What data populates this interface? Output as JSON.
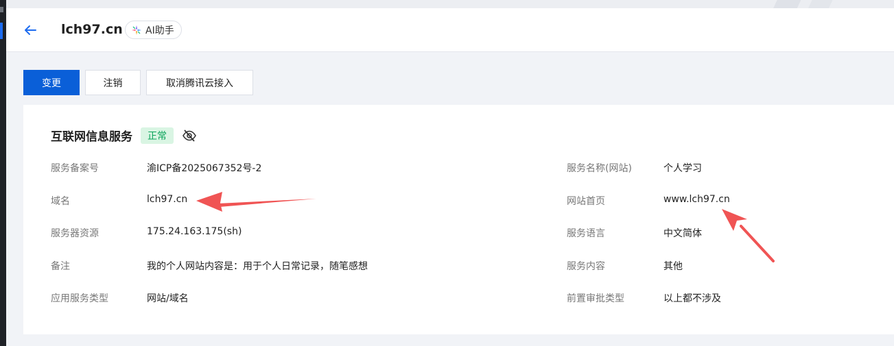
{
  "header": {
    "title": "lch97.cn",
    "ai_label": "AI助手"
  },
  "actions": {
    "change": "变更",
    "cancel_record": "注销",
    "cancel_access": "取消腾讯云接入"
  },
  "card": {
    "title": "互联网信息服务",
    "status": "正常",
    "left": [
      {
        "label": "服务备案号",
        "value": "渝ICP备2025067352号-2"
      },
      {
        "label": "域名",
        "value": "lch97.cn"
      },
      {
        "label": "服务器资源",
        "value": "175.24.163.175(sh)"
      },
      {
        "label": "备注",
        "value": "我的个人网站内容是：用于个人日常记录，随笔感想"
      },
      {
        "label": "应用服务类型",
        "value": "网站/域名"
      }
    ],
    "right": [
      {
        "label": "服务名称(网站)",
        "value": "个人学习"
      },
      {
        "label": "网站首页",
        "value": "www.lch97.cn"
      },
      {
        "label": "服务语言",
        "value": "中文简体"
      },
      {
        "label": "服务内容",
        "value": "其他"
      },
      {
        "label": "前置审批类型",
        "value": "以上都不涉及"
      }
    ]
  },
  "colors": {
    "primary": "#0a5fd8",
    "status_bg": "#d9f5e3",
    "status_text": "#0aa35a",
    "annotation": "#f05454"
  }
}
